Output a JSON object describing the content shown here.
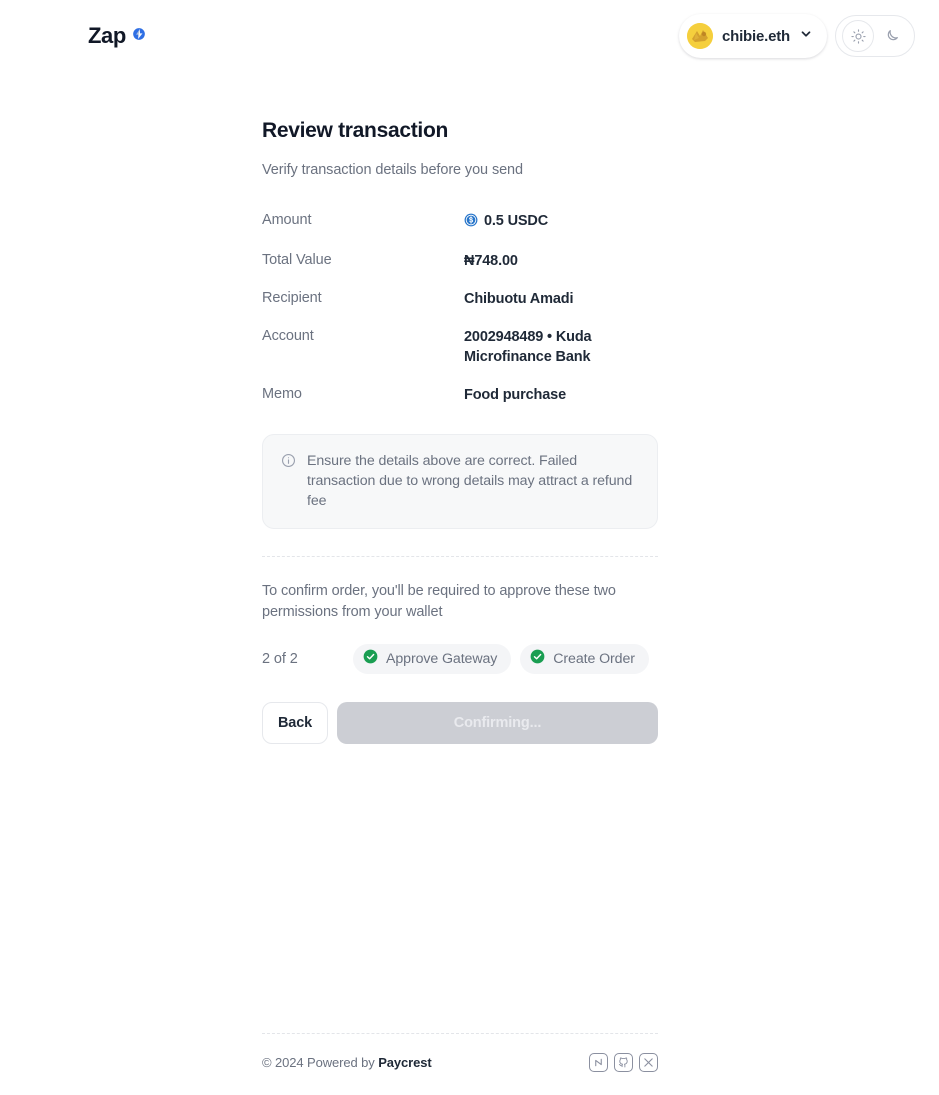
{
  "header": {
    "brand": {
      "name": "Zap",
      "icon": "zap-logo-icon"
    },
    "wallet": {
      "label": "chibie.eth",
      "avatar": "wallet-avatar",
      "chevron": "chevron-down-icon"
    },
    "theme": {
      "light_icon": "sun-icon",
      "dark_icon": "moon-icon",
      "active": "light"
    }
  },
  "main": {
    "title": "Review transaction",
    "subtitle": "Verify transaction details before you send",
    "rows": [
      {
        "label": "Amount",
        "value": "0.5 USDC",
        "icon": "usdc-token-icon"
      },
      {
        "label": "Total Value",
        "value": "₦748.00",
        "icon": ""
      },
      {
        "label": "Recipient",
        "value": "Chibuotu Amadi",
        "icon": ""
      },
      {
        "label": "Account",
        "value": "2002948489 • Kuda Microfinance Bank",
        "icon": ""
      },
      {
        "label": "Memo",
        "value": "Food purchase",
        "icon": ""
      }
    ],
    "notice": {
      "icon": "info-circle-icon",
      "text": "Ensure the details above are correct. Failed transaction due to wrong details may attract a refund fee"
    },
    "permissions_text": "To confirm order, you'll be required to approve these two permissions from your wallet",
    "steps": {
      "count_label": "2 of 2",
      "items": [
        {
          "label": "Approve Gateway",
          "state": "done"
        },
        {
          "label": "Create Order",
          "state": "done"
        }
      ]
    },
    "actions": {
      "back_label": "Back",
      "confirm_label": "Confirming...",
      "confirm_disabled": true
    }
  },
  "footer": {
    "copyright": "© 2024 Powered by ",
    "brand": "Paycrest",
    "socials": [
      {
        "name": "notion-icon",
        "glyph": "n"
      },
      {
        "name": "github-icon",
        "glyph": "g"
      },
      {
        "name": "x-twitter-icon",
        "glyph": "X"
      }
    ]
  },
  "colors": {
    "accent_blue": "#2775ca",
    "success_green": "#1a9e52",
    "avatar_yellow": "#f5cf3d",
    "text_primary": "#1f2937",
    "text_muted": "#6b7280"
  }
}
